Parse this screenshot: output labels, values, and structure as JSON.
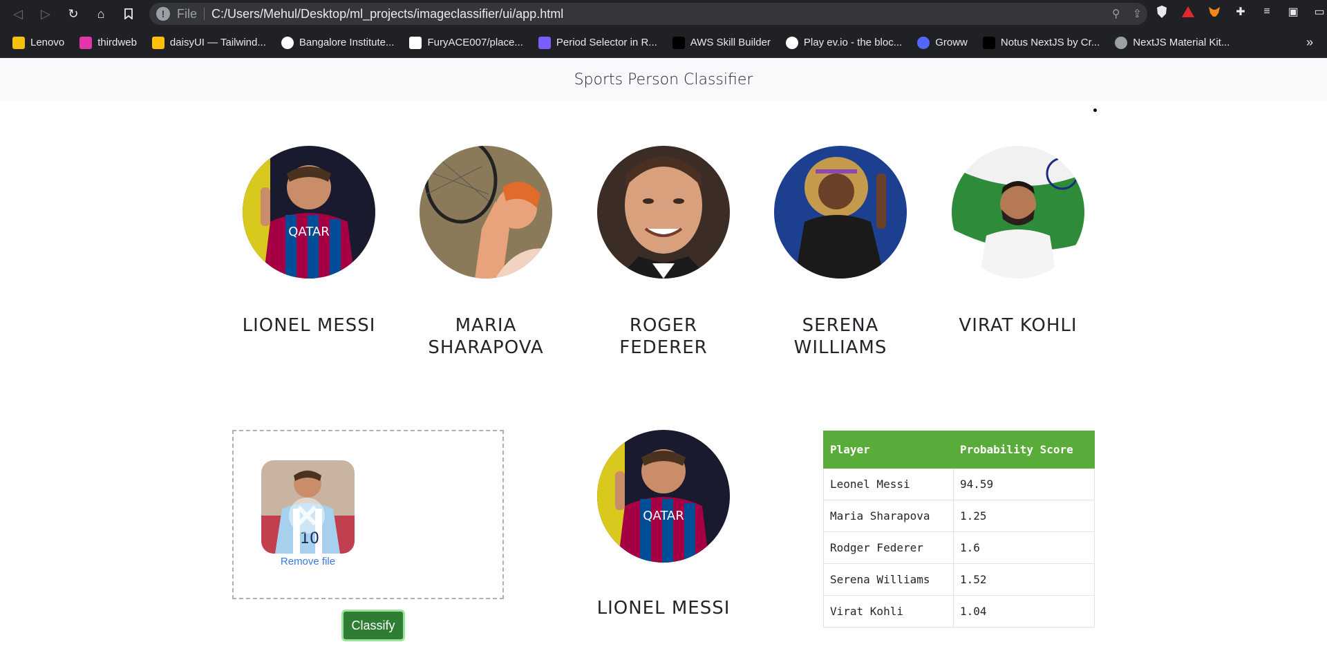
{
  "browser": {
    "scheme": "File",
    "url": "C:/Users/Mehul/Desktop/ml_projects/imageclassifier/ui/app.html",
    "bookmarks": [
      {
        "label": "Lenovo",
        "icon": "folder-icon",
        "color": "#f4c20d"
      },
      {
        "label": "thirdweb",
        "icon": "thirdweb-icon",
        "color": "#e535ab"
      },
      {
        "label": "daisyUI — Tailwind...",
        "icon": "flower-icon",
        "color": "#ffc107"
      },
      {
        "label": "Bangalore Institute...",
        "icon": "google-icon",
        "color": "#ffffff"
      },
      {
        "label": "FuryACE007/place...",
        "icon": "github-icon",
        "color": "#ffffff"
      },
      {
        "label": "Period Selector in R...",
        "icon": "grid-icon",
        "color": "#7b5cff"
      },
      {
        "label": "AWS Skill Builder",
        "icon": "aws-icon",
        "color": "#000000"
      },
      {
        "label": "Play ev.io - the bloc...",
        "icon": "evio-icon",
        "color": "#ffffff"
      },
      {
        "label": "Groww",
        "icon": "groww-icon",
        "color": "#5367ff"
      },
      {
        "label": "Notus NextJS by Cr...",
        "icon": "notus-icon",
        "color": "#000000"
      },
      {
        "label": "NextJS Material Kit...",
        "icon": "globe-icon",
        "color": "#9aa0a6"
      }
    ]
  },
  "app": {
    "title": "Sports Person Classifier"
  },
  "players": [
    {
      "name": "LIONEL MESSI",
      "image": "messi-photo",
      "jersey_colors": [
        "#a50044",
        "#004d98"
      ]
    },
    {
      "name": "MARIA SHARAPOVA",
      "image": "sharapova-photo"
    },
    {
      "name": "ROGER FEDERER",
      "image": "federer-photo"
    },
    {
      "name": "SERENA WILLIAMS",
      "image": "serena-photo"
    },
    {
      "name": "VIRAT KOHLI",
      "image": "kohli-photo"
    }
  ],
  "upload": {
    "remove_label": "Remove file",
    "classify_label": "Classify"
  },
  "result": {
    "name": "LIONEL MESSI"
  },
  "table": {
    "headers": [
      "Player",
      "Probability Score"
    ],
    "rows": [
      [
        "Leonel Messi",
        "94.59"
      ],
      [
        "Maria Sharapova",
        "1.25"
      ],
      [
        "Rodger Federer",
        "1.6"
      ],
      [
        "Serena Williams",
        "1.52"
      ],
      [
        "Virat Kohli",
        "1.04"
      ]
    ],
    "header_color": "#5aac3a"
  }
}
